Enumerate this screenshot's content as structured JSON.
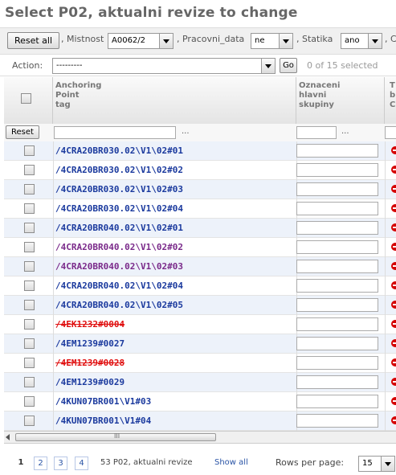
{
  "page_title": "Select P02, aktualni revize to change",
  "filters": {
    "reset_all_label": "Reset all",
    "mistnost_label": ", Mistnost",
    "mistnost_value": "A0062/2",
    "pracovni_data_label": ", Pracovni_data",
    "pracovni_data_value": "ne",
    "statika_label": ", Statika",
    "statika_value": "ano",
    "more_label": ", C"
  },
  "actions": {
    "label": "Action:",
    "selected_value": "---------",
    "go_label": "Go",
    "selection_counter": "0 of 15 selected"
  },
  "table": {
    "headers": {
      "anchoring_point_tag": "Anchoring\nPoint\ntag",
      "oznaceni_hlavni_skupiny": "Oznaceni\nhlavni\nskupiny",
      "next_col": "T\nb\nC"
    },
    "reset_label": "Reset",
    "filter_dots": "...",
    "rows": [
      {
        "tag": "/4CRA20BR030.02\\V1\\02#01",
        "style": "normal"
      },
      {
        "tag": "/4CRA20BR030.02\\V1\\02#02",
        "style": "normal"
      },
      {
        "tag": "/4CRA20BR030.02\\V1\\02#03",
        "style": "normal"
      },
      {
        "tag": "/4CRA20BR030.02\\V1\\02#04",
        "style": "normal"
      },
      {
        "tag": "/4CRA20BR040.02\\V1\\02#01",
        "style": "normal"
      },
      {
        "tag": "/4CRA20BR040.02\\V1\\02#02",
        "style": "visited"
      },
      {
        "tag": "/4CRA20BR040.02\\V1\\02#03",
        "style": "visited"
      },
      {
        "tag": "/4CRA20BR040.02\\V1\\02#04",
        "style": "normal"
      },
      {
        "tag": "/4CRA20BR040.02\\V1\\02#05",
        "style": "normal"
      },
      {
        "tag": "/4EK1232#0004",
        "style": "strike"
      },
      {
        "tag": "/4EM1239#0027",
        "style": "normal"
      },
      {
        "tag": "/4EM1239#0028",
        "style": "strike"
      },
      {
        "tag": "/4EM1239#0029",
        "style": "normal"
      },
      {
        "tag": "/4KUN07BR001\\V1#03",
        "style": "normal"
      },
      {
        "tag": "/4KUN07BR001\\V1#04",
        "style": "normal"
      }
    ]
  },
  "scrollbar": {
    "grip": "III"
  },
  "pagination": {
    "current_page": "1",
    "pages": [
      "2",
      "3",
      "4"
    ],
    "summary": "53 P02, aktualni revize",
    "show_all_label": "Show all",
    "rows_per_page_label": "Rows per page:",
    "rows_per_page_value": "15"
  },
  "colors": {
    "link": "#1b3a9e",
    "visited_link": "#7a2a8a",
    "deleted": "#e01010",
    "row_alt": "#edf2fa"
  }
}
